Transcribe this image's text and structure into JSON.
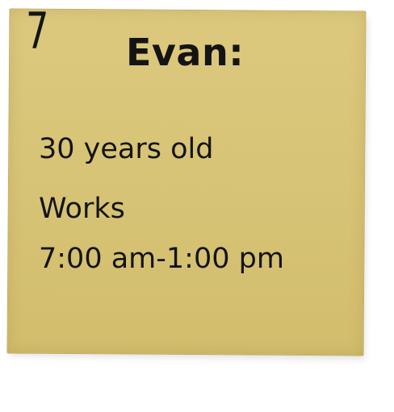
{
  "note": {
    "number": "7",
    "name": "Evan:",
    "age": "30 years old",
    "works_label": "Works",
    "hours": "7:00 am-1:00 pm",
    "colors": {
      "paper": "#d7c375",
      "ink": "#141414"
    }
  }
}
